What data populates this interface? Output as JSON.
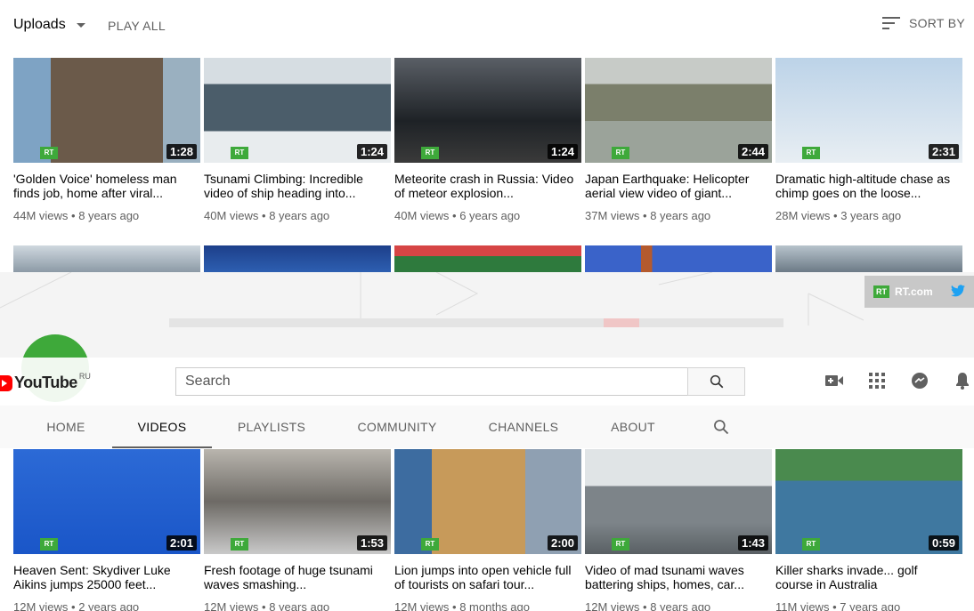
{
  "uploads_bar": {
    "dropdown_label": "Uploads",
    "play_all": "PLAY ALL",
    "sort_by": "SORT BY"
  },
  "row1": [
    {
      "title": "'Golden Voice' homeless man finds job, home after viral...",
      "views": "44M views",
      "age": "8 years ago",
      "duration": "1:28",
      "scene": "portrait"
    },
    {
      "title": "Tsunami Climbing: Incredible video of ship heading into...",
      "views": "40M views",
      "age": "8 years ago",
      "duration": "1:24",
      "scene": "sea"
    },
    {
      "title": "Meteorite crash in Russia: Video of meteor explosion...",
      "views": "40M views",
      "age": "6 years ago",
      "duration": "1:24",
      "scene": "night"
    },
    {
      "title": "Japan Earthquake: Helicopter aerial view video of giant...",
      "views": "37M views",
      "age": "8 years ago",
      "duration": "2:44",
      "scene": "aerial"
    },
    {
      "title": "Dramatic high-altitude chase as chimp goes on the loose...",
      "views": "28M views",
      "age": "3 years ago",
      "duration": "2:31",
      "scene": "pole"
    }
  ],
  "banner": {
    "rt_logo": "RT",
    "rt_site": "RT.com"
  },
  "masthead": {
    "logo_word": "YouTube",
    "country": "RU",
    "search_placeholder": "Search"
  },
  "tabs": [
    "HOME",
    "VIDEOS",
    "PLAYLISTS",
    "COMMUNITY",
    "CHANNELS",
    "ABOUT"
  ],
  "active_tab": "VIDEOS",
  "row2": [
    {
      "title": "Heaven Sent: Skydiver Luke Aikins jumps 25000 feet...",
      "views": "12M views",
      "age": "2 years ago",
      "duration": "2:01",
      "scene": "net"
    },
    {
      "title": "Fresh footage of huge tsunami waves smashing...",
      "views": "12M views",
      "age": "8 years ago",
      "duration": "1:53",
      "scene": "flood"
    },
    {
      "title": "Lion jumps into open vehicle full of tourists on safari tour...",
      "views": "12M views",
      "age": "8 months ago",
      "duration": "2:00",
      "scene": "lion"
    },
    {
      "title": "Video of mad tsunami waves battering ships, homes, car...",
      "views": "12M views",
      "age": "8 years ago",
      "duration": "1:43",
      "scene": "harbor"
    },
    {
      "title": "Killer sharks invade... golf course in Australia",
      "views": "11M views",
      "age": "7 years ago",
      "duration": "0:59",
      "scene": "shark"
    }
  ],
  "colors": {
    "rt_green": "#3ea93a",
    "youtube_red": "#ff0000",
    "text_secondary": "#606060"
  }
}
